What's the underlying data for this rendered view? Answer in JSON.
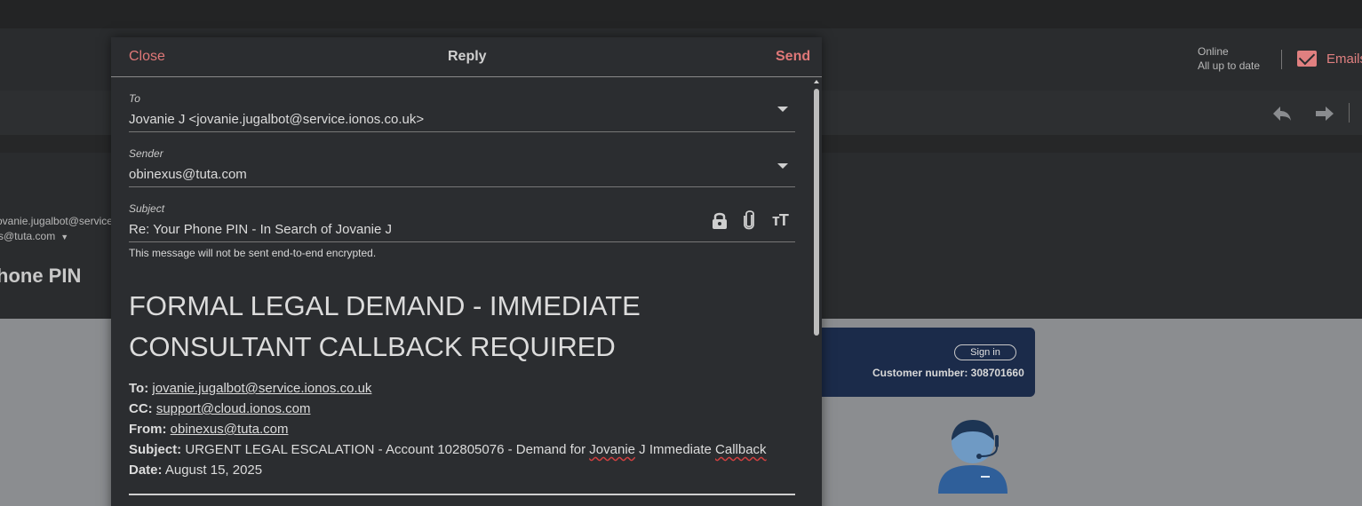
{
  "background": {
    "status_line1": "Online",
    "status_line2": "All up to date",
    "email_label": "Emails",
    "from_partial": "ovanie.jugalbot@service",
    "to_partial": "s@tuta.com",
    "subject_partial": "hone PIN",
    "sign_in": "Sign in",
    "customer_number": "Customer number: 308701660",
    "accent_color": "#e07878"
  },
  "dialog": {
    "close": "Close",
    "title": "Reply",
    "send": "Send",
    "to_label": "To",
    "to_value": "Jovanie J <jovanie.jugalbot@service.ionos.co.uk>",
    "sender_label": "Sender",
    "sender_value": "obinexus@tuta.com",
    "subject_label": "Subject",
    "subject_value": "Re: Your Phone PIN - In Search of Jovanie J",
    "notice": "This message will not be sent end-to-end encrypted."
  },
  "body": {
    "heading": "FORMAL LEGAL DEMAND - IMMEDIATE CONSULTANT CALLBACK REQUIRED",
    "to_key": "To:",
    "to_val": "jovanie.jugalbot@service.ionos.co.uk",
    "cc_key": "CC:",
    "cc_val": "support@cloud.ionos.com",
    "from_key": "From:",
    "from_val": "obinexus@tuta.com",
    "subject_key": "Subject:",
    "subject_val_pre": "URGENT LEGAL ESCALATION - Account 102805076 - Demand for ",
    "subject_name": "Jovanie",
    "subject_mid": " J Immediate ",
    "subject_end": "Callback",
    "date_key": "Date:",
    "date_val": "August 15, 2025"
  }
}
